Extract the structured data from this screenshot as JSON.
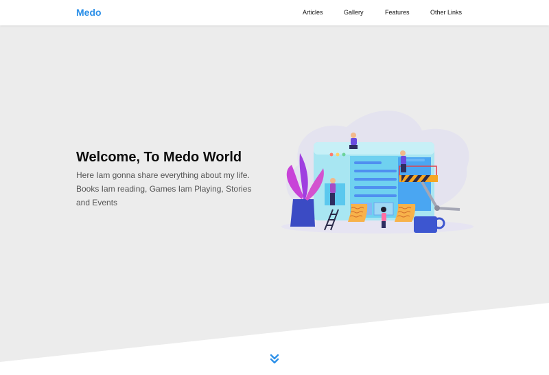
{
  "brand": {
    "name": "Medo",
    "color": "#2b8fe8"
  },
  "nav": {
    "items": [
      {
        "label": "Articles"
      },
      {
        "label": "Gallery"
      },
      {
        "label": "Features"
      },
      {
        "label": "Other Links"
      }
    ]
  },
  "hero": {
    "title": "Welcome, To Medo World",
    "description": "Here Iam gonna share everything about my life. Books Iam reading, Games Iam Playing, Stories and Events",
    "background": "#ececec"
  },
  "scroll": {
    "icon": "double-chevron-down-icon"
  }
}
